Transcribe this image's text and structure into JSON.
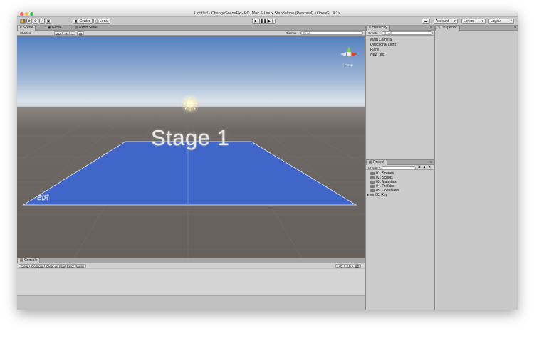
{
  "window": {
    "title": "Untitled - ChangeSceneEx - PC, Mac & Linux Standalone (Personal) <OpenGL 4.1>"
  },
  "toolbar": {
    "center_label": "Center",
    "local_label": "Local",
    "account_label": "Account",
    "layers_label": "Layers",
    "layout_label": "Layout"
  },
  "scene": {
    "tabs": [
      "Scene",
      "Game",
      "Asset Store"
    ],
    "shading_mode": "Shaded",
    "mode_2d": "2D",
    "gizmos_label": "Gizmos",
    "search_placeholder": "Q▾All",
    "persp_label": "< Persp",
    "stage_text": "Stage 1"
  },
  "hierarchy": {
    "tab": "Hierarchy",
    "create_label": "Create",
    "search_placeholder": "Q▾All",
    "items": [
      "Main Camera",
      "Directional Light",
      "Plane",
      "New Text"
    ]
  },
  "project": {
    "tab": "Project",
    "create_label": "Create",
    "items": [
      "01. Scenes",
      "02. Scripts",
      "03. Materials",
      "04. Prefabs",
      "05. Controllers",
      "06. Res"
    ]
  },
  "inspector": {
    "tab": "Inspector"
  },
  "console": {
    "tab": "Console",
    "buttons": [
      "Clear",
      "Collapse",
      "Clear on Play",
      "Error Pause"
    ],
    "counts": [
      "0",
      "0",
      "0"
    ]
  },
  "colors": {
    "sky_top": "#5a83c0",
    "horizon": "#c9d4e0",
    "ground": "#6a6461",
    "plane": "#3f66c8"
  }
}
